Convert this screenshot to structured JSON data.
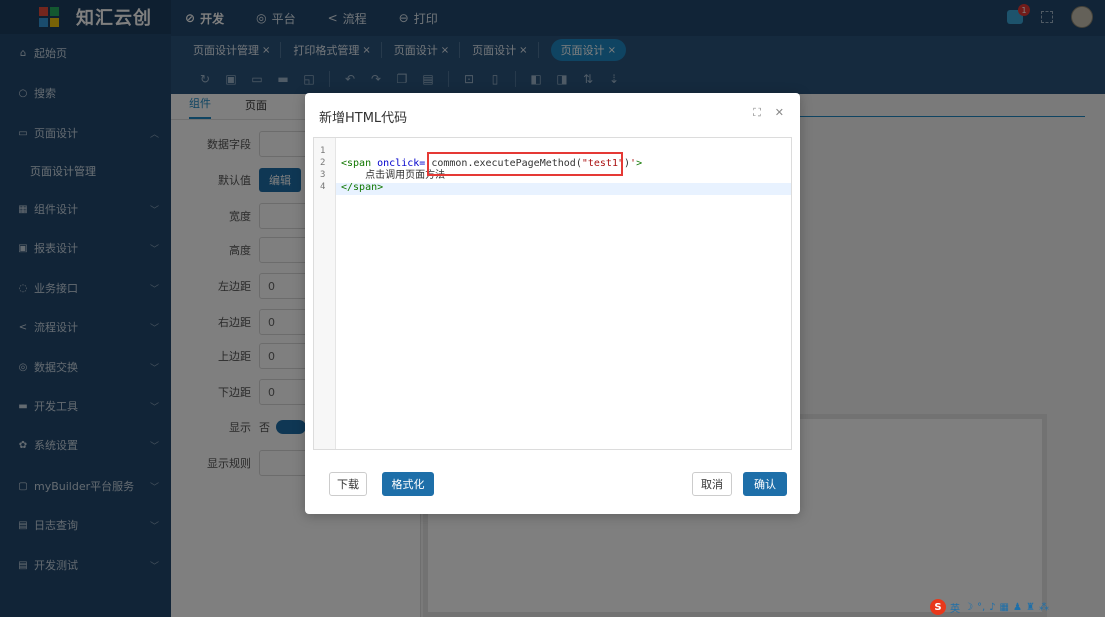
{
  "app": {
    "title": "知汇云创"
  },
  "topnav": [
    {
      "icon": "dev-icon",
      "label": "开发",
      "active": true
    },
    {
      "icon": "platform-icon",
      "label": "平台",
      "active": false
    },
    {
      "icon": "flow-icon",
      "label": "流程",
      "active": false
    },
    {
      "icon": "print-icon",
      "label": "打印",
      "active": false
    }
  ],
  "topright": {
    "badge_count": "1"
  },
  "sidebar": {
    "items": [
      {
        "label": "起始页",
        "icon": "home-icon"
      },
      {
        "label": "搜索",
        "icon": "search-icon"
      },
      {
        "label": "页面设计",
        "icon": "page-design-icon"
      },
      {
        "label": "页面设计管理",
        "icon": ""
      },
      {
        "label": "组件设计",
        "icon": "grid-icon"
      },
      {
        "label": "报表设计",
        "icon": "report-icon"
      },
      {
        "label": "业务接口",
        "icon": "interface-icon"
      },
      {
        "label": "流程设计",
        "icon": "share-icon"
      },
      {
        "label": "数据交换",
        "icon": "database-icon"
      },
      {
        "label": "开发工具",
        "icon": "toolbox-icon"
      },
      {
        "label": "系统设置",
        "icon": "gear-icon"
      },
      {
        "label": "myBuilder平台服务",
        "icon": "chat-icon"
      },
      {
        "label": "日志查询",
        "icon": "log-icon"
      },
      {
        "label": "开发测试",
        "icon": "test-icon"
      }
    ]
  },
  "tabs": [
    {
      "label": "页面设计管理",
      "active": false
    },
    {
      "label": "打印格式管理",
      "active": false
    },
    {
      "label": "页面设计",
      "active": false
    },
    {
      "label": "页面设计",
      "active": false
    },
    {
      "label": "页面设计",
      "active": true
    }
  ],
  "panel": {
    "tabs": [
      "组件",
      "页面"
    ],
    "props": [
      {
        "label": "数据字段",
        "value": ""
      },
      {
        "label": "默认值",
        "value": "编辑"
      },
      {
        "label": "宽度",
        "value": ""
      },
      {
        "label": "高度",
        "value": ""
      },
      {
        "label": "左边距",
        "value": "0"
      },
      {
        "label": "右边距",
        "value": "0"
      },
      {
        "label": "上边距",
        "value": "0"
      },
      {
        "label": "下边距",
        "value": "0"
      },
      {
        "label": "显示",
        "value": "否"
      },
      {
        "label": "显示规则",
        "value": ""
      }
    ]
  },
  "modal": {
    "title": "新增HTML代码",
    "code": {
      "line_numbers": [
        "1",
        "2",
        "3",
        "4"
      ],
      "line2_tag_open": "<span ",
      "line2_attr": "onclick=",
      "line2_q": "'",
      "line2_value_prefix": "common.executePageMethod(",
      "line2_str": "\"test1\"",
      "line2_value_suffix": ")",
      "line2_q2": "'",
      "line2_tag_end": ">",
      "line3_text": "    点击调用页面方法",
      "line4_close": "</span>"
    },
    "buttons": {
      "download": "下载",
      "format": "格式化",
      "cancel": "取消",
      "confirm": "确认"
    }
  },
  "ime": {
    "lang": "英"
  }
}
